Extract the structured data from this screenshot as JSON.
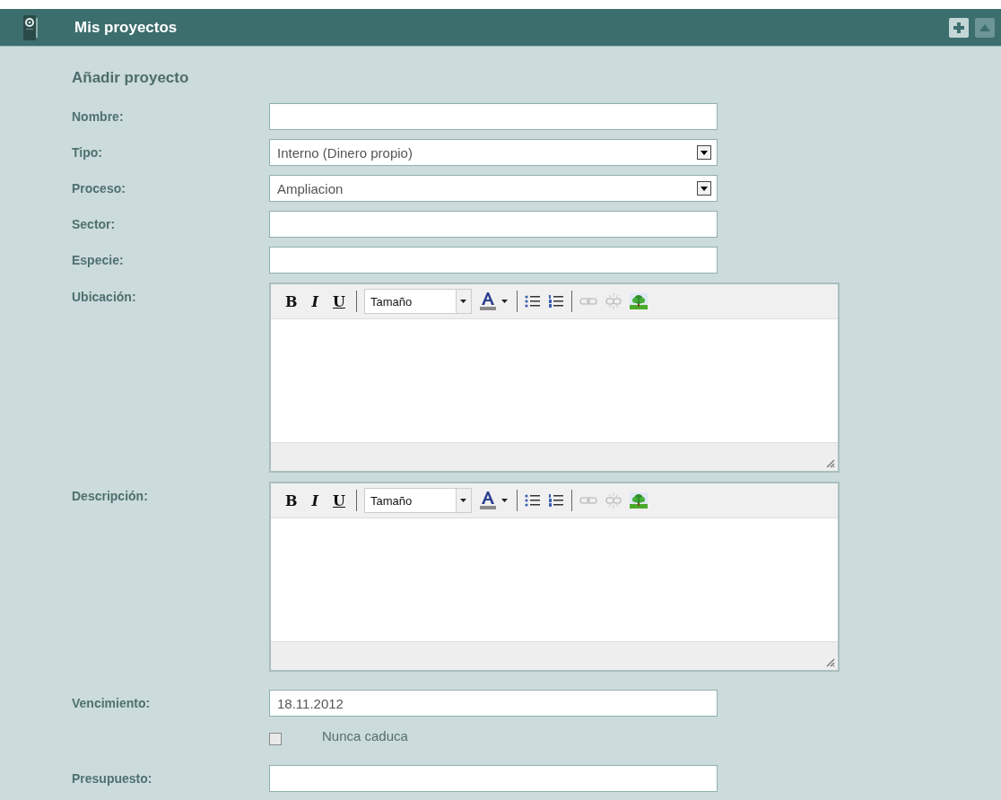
{
  "header": {
    "title": "Mis proyectos"
  },
  "form": {
    "title": "Añadir proyecto",
    "fields": [
      {
        "kind": "text",
        "label": "Nombre:"
      },
      {
        "kind": "select",
        "label": "Tipo:",
        "value": "Interno (Dinero propio)"
      },
      {
        "kind": "select",
        "label": "Proceso:",
        "value": "Ampliacion"
      },
      {
        "kind": "text",
        "label": "Sector:"
      },
      {
        "kind": "text",
        "label": "Especie:"
      },
      {
        "kind": "editor",
        "label": "Ubicación:",
        "toolbar": {
          "bold": "B",
          "italic": "I",
          "underline": "U",
          "font_size": "Tamaño"
        }
      },
      {
        "kind": "editor",
        "label": "Descripción:",
        "toolbar": {
          "bold": "B",
          "italic": "I",
          "underline": "U",
          "font_size": "Tamaño"
        }
      },
      {
        "kind": "text",
        "label": "Vencimiento:",
        "value": "18.11.2012"
      },
      {
        "kind": "checkbox",
        "label": "Nunca caduca",
        "checked": false
      },
      {
        "kind": "text",
        "label": "Presupuesto:"
      }
    ]
  }
}
